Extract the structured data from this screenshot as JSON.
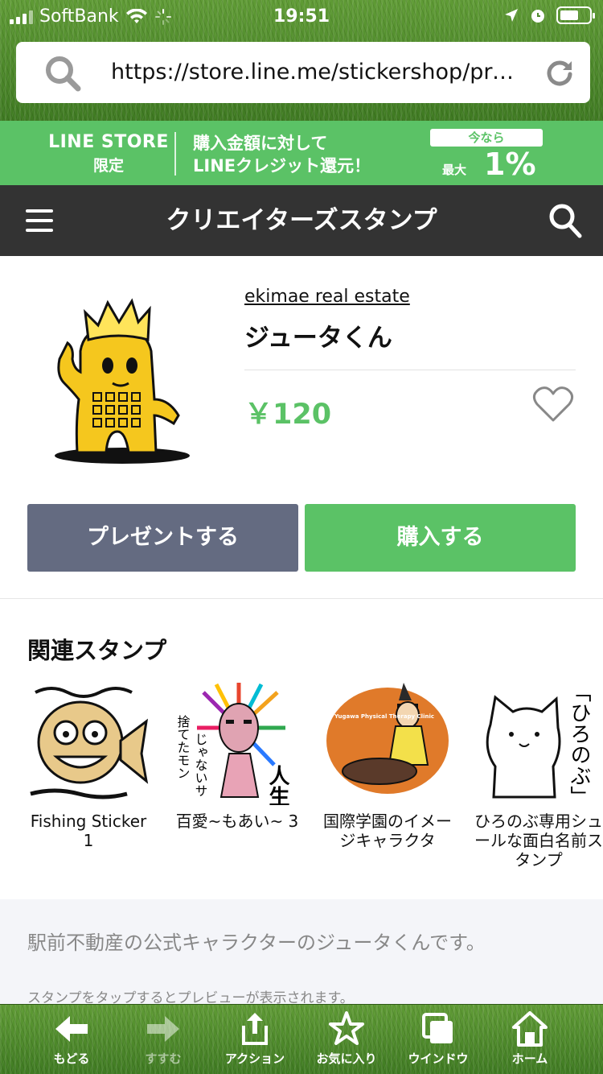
{
  "status_bar": {
    "carrier": "SoftBank",
    "time": "19:51"
  },
  "browser": {
    "url": "https://store.line.me/stickershop/pro…"
  },
  "promo_banner": {
    "brand_line1": "LINE STORE",
    "brand_line2": "限定",
    "message_line1": "購入金額に対して",
    "message_line2": "LINEクレジット還元！",
    "pill": "今なら",
    "max_label": "最大",
    "percent": "1%"
  },
  "nav": {
    "title": "クリエイターズスタンプ"
  },
  "product": {
    "author": "ekimae real estate",
    "name": "ジュータくん",
    "price": "￥120",
    "present_label": "プレゼントする",
    "buy_label": "購入する"
  },
  "related": {
    "heading": "関連スタンプ",
    "items": [
      {
        "title": "Fishing Sticker 1"
      },
      {
        "title": "百愛~もあい~ 3"
      },
      {
        "title": "国際学園のイメージキャラクタ"
      },
      {
        "title": "ひろのぶ専用シュールな面白名前スタンプ"
      }
    ],
    "sticker_text": {
      "moai_line1": "捨てたモン",
      "moai_line2": "じゃないサ",
      "moai_kanji": "人生",
      "clinic": "Yugawa Physical Therapy Clinic",
      "hironobu": "「ひろのぶ」"
    }
  },
  "description": {
    "text": "駅前不動産の公式キャラクターのジュータくんです。",
    "hint": "スタンプをタップするとプレビューが表示されます。"
  },
  "toolbar": {
    "back": "もどる",
    "forward": "すすむ",
    "action": "アクション",
    "favorite": "お気に入り",
    "window": "ウインドウ",
    "home": "ホーム"
  }
}
